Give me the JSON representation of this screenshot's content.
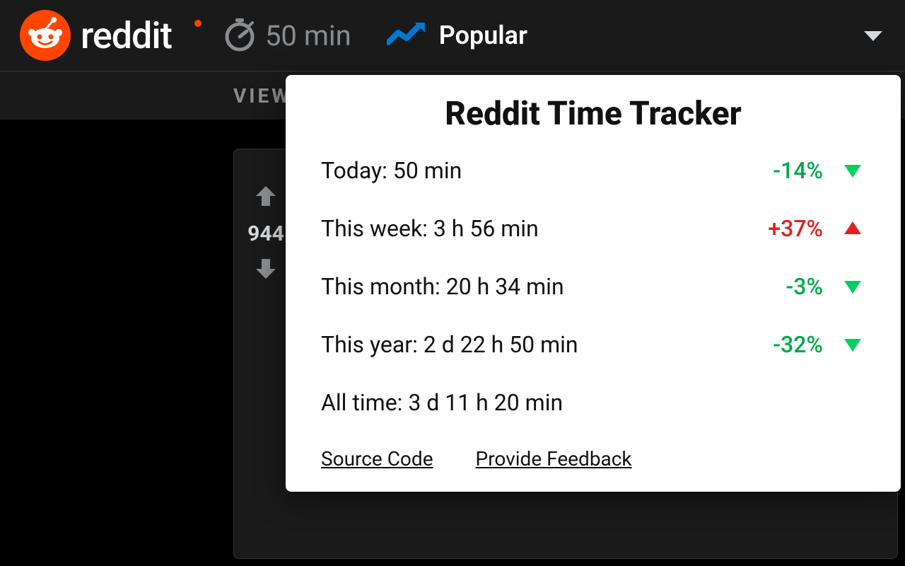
{
  "header": {
    "brand": "reddit",
    "timer_label": "50 min",
    "nav_label": "Popular"
  },
  "subbar": {
    "label": "VIEW"
  },
  "post": {
    "score": "944"
  },
  "popup": {
    "title": "Reddit Time Tracker",
    "rows": [
      {
        "label": "Today: 50 min",
        "pct": "-14%",
        "dir": "down",
        "color": "green"
      },
      {
        "label": "This week: 3 h 56 min",
        "pct": "+37%",
        "dir": "up",
        "color": "red"
      },
      {
        "label": "This month: 20 h 34 min",
        "pct": "-3%",
        "dir": "down",
        "color": "green"
      },
      {
        "label": "This year: 2 d 22 h 50 min",
        "pct": "-32%",
        "dir": "down",
        "color": "green"
      },
      {
        "label": "All time: 3 d 11 h 20 min",
        "pct": "",
        "dir": "",
        "color": ""
      }
    ],
    "link_source": "Source Code",
    "link_feedback": "Provide Feedback"
  }
}
